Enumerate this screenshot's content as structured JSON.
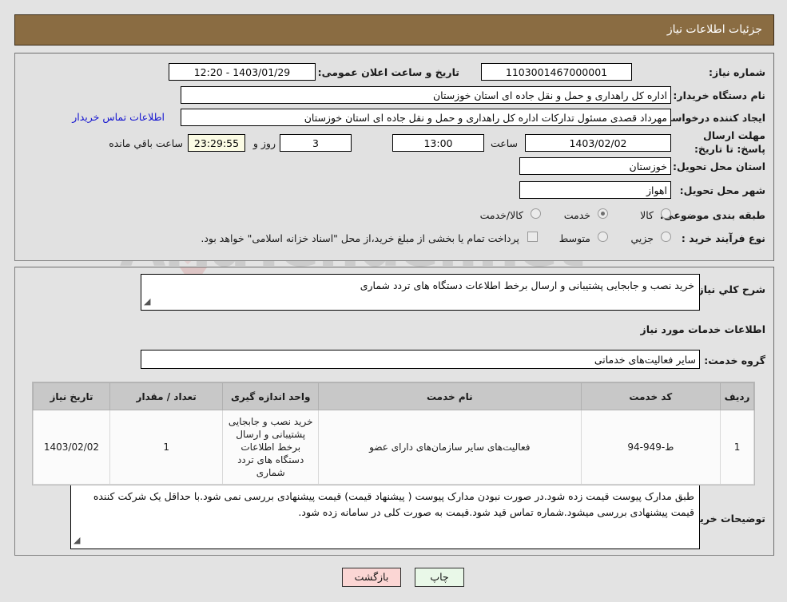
{
  "header": {
    "title": "جزئیات اطلاعات نیاز"
  },
  "form": {
    "need_number_label": "شماره نیاز:",
    "need_number_value": "1103001467000001",
    "public_announce_label": "تاریخ و ساعت اعلان عمومی:",
    "public_announce_value": "1403/01/29 - 12:20",
    "buyer_org_label": "نام دستگاه خریدار:",
    "buyer_org_value": "اداره کل راهداری و حمل و نقل جاده ای استان خوزستان",
    "requester_label": "ایجاد کننده درخواست:",
    "requester_value": "مهرداد قصدی مسئول تدارکات اداره کل راهداری و حمل و نقل جاده ای استان خوزستان",
    "contact_link": "اطلاعات تماس خریدار",
    "deadline_label": "مهلت ارسال پاسخ: تا تاریخ:",
    "deadline_date": "1403/02/02",
    "hour_label": "ساعت",
    "hour_value": "13:00",
    "days_value": "3",
    "days_unit_label": "روز و",
    "remaining_value": "23:29:55",
    "remaining_label": "ساعت باقي مانده",
    "province_label": "استان محل تحویل:",
    "province_value": "خوزستان",
    "city_label": "شهر محل تحویل:",
    "city_value": "اهواز",
    "category_label": "طبقه بندی موضوعی:",
    "category_options": [
      {
        "label": "کالا",
        "selected": false
      },
      {
        "label": "خدمت",
        "selected": true
      },
      {
        "label": "کالا/خدمت",
        "selected": false
      }
    ],
    "process_label": "نوع فرآیند خرید :",
    "process_options": [
      {
        "label": "جزیي",
        "selected": false
      },
      {
        "label": "متوسط",
        "selected": false
      }
    ],
    "treasury_checkbox_label": "پرداخت تمام یا بخشی از مبلغ خرید،از محل \"اسناد خزانه اسلامی\" خواهد بود.",
    "treasury_checked": false
  },
  "need_summary": {
    "label": "شرح کلي نياز:",
    "value": "خرید نصب و جابجایی پشتیبانی و ارسال برخط اطلاعات دستگاه های تردد شماری"
  },
  "services_section": {
    "title": "اطلاعات خدمات مورد نیاز",
    "group_label": "گروه خدمت:",
    "group_value": "سایر فعالیت‌های خدماتی"
  },
  "table": {
    "columns": [
      "ردیف",
      "کد خدمت",
      "نام خدمت",
      "واحد اندازه گیری",
      "تعداد / مقدار",
      "تاریخ نیاز"
    ],
    "rows": [
      {
        "radif": "1",
        "code": "ط-949-94",
        "name": "فعالیت‌های سایر سازمان‌های دارای عضو",
        "unit": "خرید نصب و جابجایی پشتیبانی و ارسال برخط اطلاعات دستگاه های تردد شماری",
        "qty": "1",
        "date": "1403/02/02"
      }
    ]
  },
  "buyer_notes": {
    "label": "توضیحات خریدار:",
    "value": "طبق مدارک پیوست قیمت زده شود.در صورت نبودن مدارک پیوست ( پیشنهاد قیمت) قیمت پیشنهادی بررسی نمی شود.با حداقل یک شرکت کننده قیمت پیشنهادی بررسی میشود.شماره تماس قید شود.قیمت به صورت کلی در سامانه زده شود."
  },
  "footer": {
    "print_label": "چاپ",
    "back_label": "بازگشت"
  },
  "watermark": {
    "text": "AriaTender.net"
  }
}
